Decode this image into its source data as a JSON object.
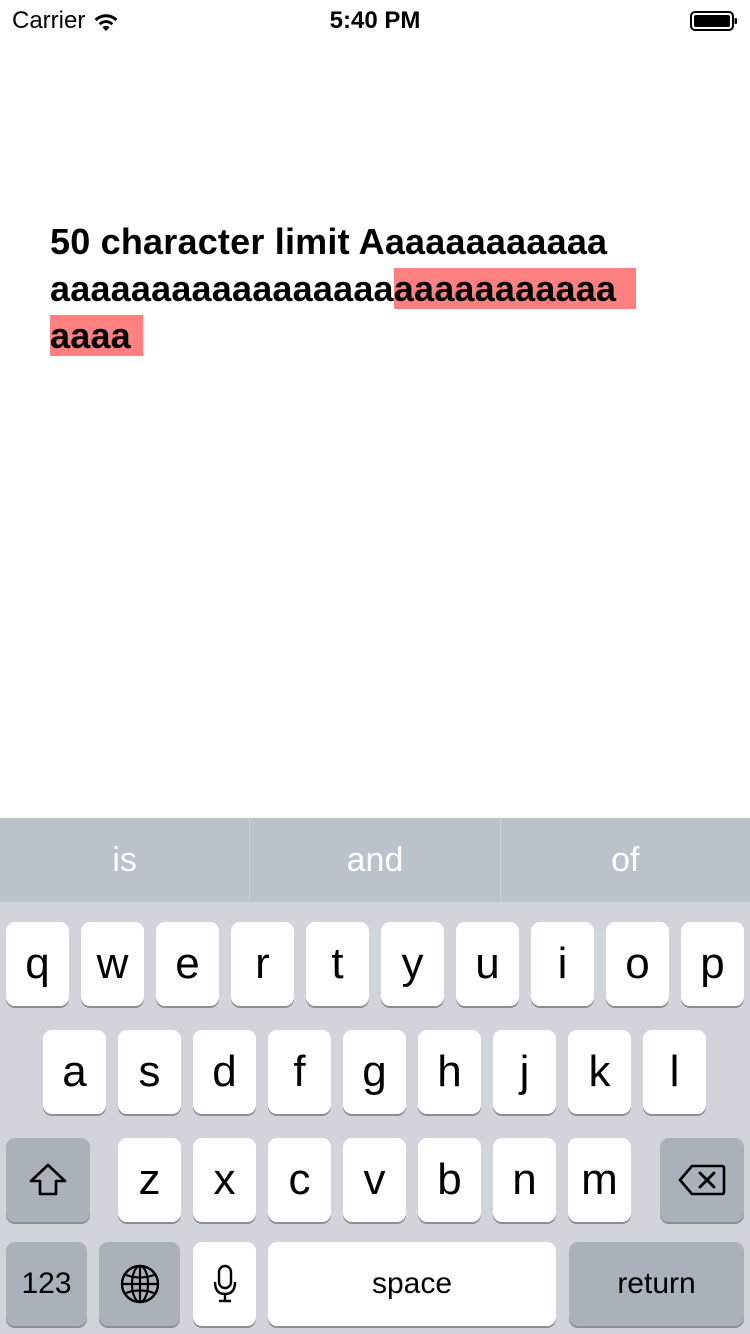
{
  "status_bar": {
    "carrier": "Carrier",
    "time": "5:40 PM",
    "icons": [
      "wifi-icon",
      "battery-icon"
    ]
  },
  "text_field": {
    "line1": "50 character limit Aaaaaaaaaaaa",
    "line2_within_limit": "aaaaaaaaaaaaaaaaa",
    "line2_over_limit": "aaaaaaaaaaa",
    "line3_over_limit": "aaaa",
    "over_limit_highlight_color": "#ff8080"
  },
  "keyboard": {
    "predictions": [
      "is",
      "and",
      "of"
    ],
    "row1": [
      "q",
      "w",
      "e",
      "r",
      "t",
      "y",
      "u",
      "i",
      "o",
      "p"
    ],
    "row2": [
      "a",
      "s",
      "d",
      "f",
      "g",
      "h",
      "j",
      "k",
      "l"
    ],
    "row3": [
      "z",
      "x",
      "c",
      "v",
      "b",
      "n",
      "m"
    ],
    "numbers_label": "123",
    "space_label": "space",
    "return_label": "return",
    "icons": [
      "shift-icon",
      "backspace-icon",
      "globe-icon",
      "microphone-icon"
    ]
  }
}
